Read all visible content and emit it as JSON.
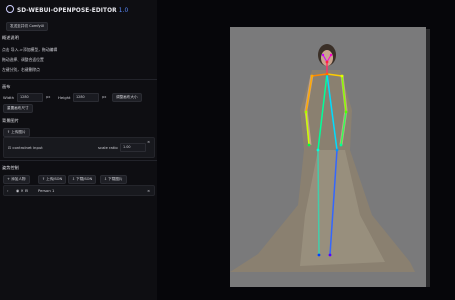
{
  "app": {
    "title": "SD-WEBUI-OPENPOSE-EDITOR",
    "version": "1.0"
  },
  "toolbar": {
    "back_button": "发送至并切 ComfyUI"
  },
  "main": {
    "section_title": "概述说明",
    "lines": [
      "点击 导入->添加模型，拖动编辑",
      "拖动选择、调整合适位置",
      "左键分别，右键删除点"
    ]
  },
  "canvas_size": {
    "heading": "画布",
    "width_label": "Width",
    "width_value": "1280",
    "width_unit": "px",
    "height_label": "Height",
    "height_value": "1280",
    "height_unit": "px",
    "resize_button": "调整画布大小",
    "reset_button": "重置画布尺寸"
  },
  "background": {
    "heading": "背景图片",
    "upload_button": "上传图片",
    "controlnet_label": "controlnet input",
    "scale_label": "scale ratio",
    "scale_value": "1.00"
  },
  "pose": {
    "heading": "姿势控制",
    "buttons": [
      "添加人物",
      "上传JSON",
      "下载JSON",
      "下载图片"
    ],
    "person_item": "Person 1"
  },
  "icons": [
    "openpose-logo-icon",
    "close-icon",
    "upload-icon",
    "chevron-down-icon",
    "eye-icon"
  ],
  "colors": {
    "accent": "#5b8cff",
    "panel": "#0e0e12",
    "canvas_bg": "#7a7a7b"
  }
}
